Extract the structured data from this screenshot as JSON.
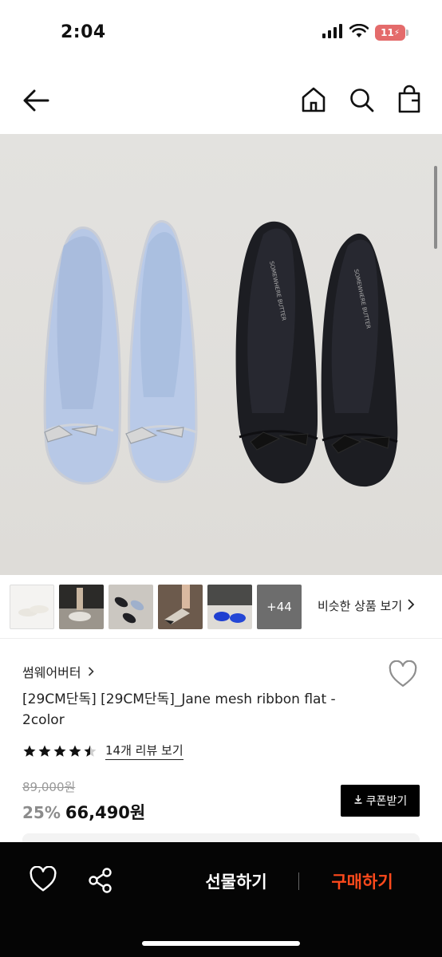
{
  "status": {
    "time": "2:04",
    "battery": "11"
  },
  "nav": {
    "back_icon": "arrow-left-icon",
    "home_icon": "home-icon",
    "search_icon": "search-icon",
    "bag_icon": "shopping-bag-icon"
  },
  "gallery": {
    "thumbs": [
      "thumb-1",
      "thumb-2",
      "thumb-3",
      "thumb-4",
      "thumb-5"
    ],
    "more_count": "+44",
    "similar_label": "비슷한 상품 보기"
  },
  "product": {
    "brand": "썸웨어버터",
    "title": "[29CM단독] [29CM단독]_Jane mesh ribbon flat - 2color",
    "rating": 4.5,
    "review_link": "14개 리뷰 보기",
    "original_price": "89,000원",
    "discount": "25%",
    "sale_price": "66,490원",
    "coupon_label": "쿠폰받기",
    "shoe_print": "SOMEWHERE BUTTER"
  },
  "bottom_bar": {
    "gift_label": "선물하기",
    "buy_label": "구매하기"
  },
  "colors": {
    "buy_accent": "#ff4a1c",
    "bottom_bar_bg": "#050505",
    "discount_gray": "#8c8c8c",
    "battery_red": "#e46b6b"
  }
}
